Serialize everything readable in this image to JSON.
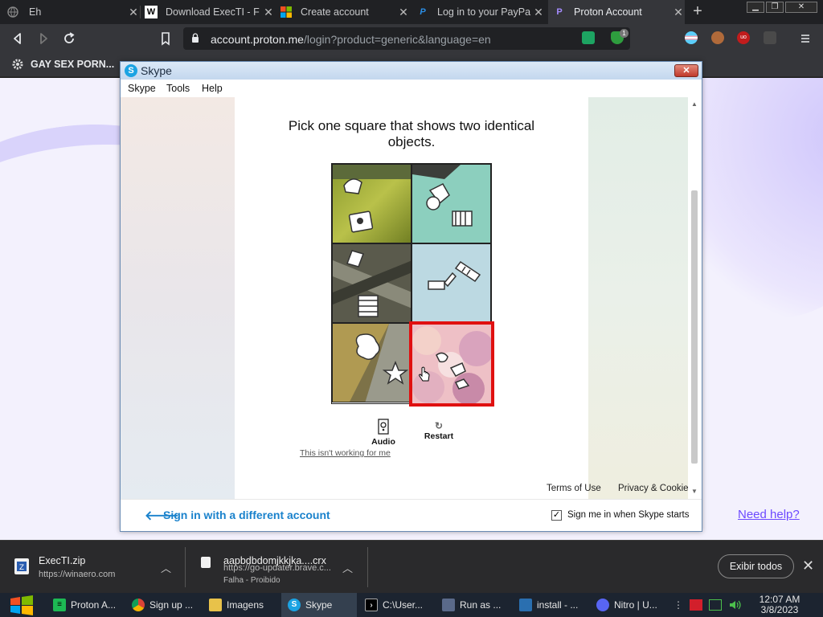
{
  "browser": {
    "tabs": [
      {
        "title": "Eh",
        "icon": "globe-icon"
      },
      {
        "title": "Download ExecTI - F",
        "icon": "wikipedia-w-icon"
      },
      {
        "title": "Create account",
        "icon": "microsoft-logo-icon"
      },
      {
        "title": "Log in to your PayPa",
        "icon": "paypal-icon"
      },
      {
        "title": "Proton Account",
        "icon": "proton-icon"
      }
    ],
    "active_tab_index": 4,
    "url_host": "account.proton.me",
    "url_rest": "/login?product=generic&language=en",
    "extension_badge": "1",
    "bookmark": "GAY SEX PORN..."
  },
  "page": {
    "need_help": "Need help?"
  },
  "skype": {
    "title": "Skype",
    "menu": [
      "Skype",
      "Tools",
      "Help"
    ],
    "captcha": {
      "prompt": "Pick one square that shows two identical objects.",
      "selected_cell": 5,
      "audio_label": "Audio",
      "restart_label": "Restart",
      "link": "This isn't working for me"
    },
    "footer": {
      "terms": "Terms of Use",
      "privacy": "Privacy & Cookie"
    },
    "bottom": {
      "back_link": "Sign in with a different account",
      "checkbox_label": "Sign me in when Skype starts",
      "checkbox_checked": true
    }
  },
  "downloads": {
    "items": [
      {
        "name": "ExecTI.zip",
        "source": "https://winaero.com",
        "status": ""
      },
      {
        "name": "aapbdbdomjkkjka....crx",
        "source": "https://go-updater.brave.c...",
        "status": "Falha - Proibido"
      }
    ],
    "show_all": "Exibir todos"
  },
  "taskbar": {
    "items": [
      {
        "label": "Proton A...",
        "icon": "spotify-icon"
      },
      {
        "label": "Sign up ...",
        "icon": "chrome-icon"
      },
      {
        "label": "Imagens",
        "icon": "image-folder-icon"
      },
      {
        "label": "Skype",
        "icon": "skype-icon"
      },
      {
        "label": "C:\\User...",
        "icon": "terminal-icon"
      },
      {
        "label": "Run as ...",
        "icon": "run-icon"
      },
      {
        "label": "install - ...",
        "icon": "installer-icon"
      },
      {
        "label": "Nitro | U...",
        "icon": "discord-icon"
      }
    ],
    "active_index": 3,
    "time": "12:07 AM",
    "date": "3/8/2023"
  },
  "colors": {
    "proton_accent": "#6d4aff",
    "skype_blue": "#1a82cc",
    "selection_red": "#e01010"
  }
}
